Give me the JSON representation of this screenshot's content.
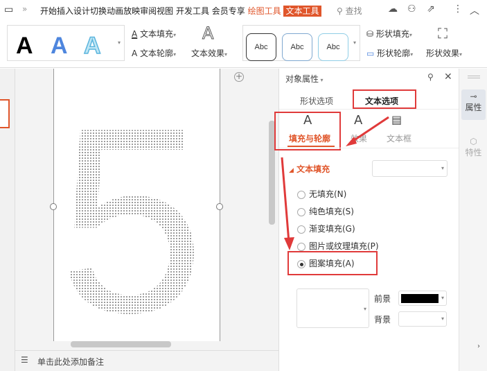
{
  "menu": {
    "items": [
      "开始",
      "插入",
      "设计",
      "切换",
      "动画",
      "放映",
      "审阅",
      "视图",
      "开发工具",
      "会员专享"
    ],
    "draw_tools": "绘图工具",
    "text_tools": "文本工具",
    "search": "查找"
  },
  "ribbon": {
    "text_styles": [
      "A",
      "A",
      "A"
    ],
    "text_fill": "文本填充",
    "text_outline": "文本轮廓",
    "text_effect": "文本效果",
    "shape_styles": [
      "Abc",
      "Abc",
      "Abc"
    ],
    "shape_fill": "形状填充",
    "shape_outline": "形状轮廓",
    "shape_effect": "形状效果"
  },
  "slide": {
    "digit": "5"
  },
  "notes": {
    "placeholder": "单击此处添加备注"
  },
  "panel": {
    "title": "对象属性",
    "tabs": [
      "形状选项",
      "文本选项"
    ],
    "subtabs": [
      "填充与轮廓",
      "效果",
      "文本框"
    ],
    "section": "文本填充",
    "options": [
      "无填充(N)",
      "纯色填充(S)",
      "渐变填充(G)",
      "图片或纹理填充(P)",
      "图案填充(A)"
    ],
    "selected": 4,
    "foreground_label": "前景",
    "background_label": "背景",
    "foreground_color": "#000000"
  },
  "side": {
    "properties": "属性",
    "features": "特性"
  },
  "colors": {
    "accent": "#e0562b",
    "highlight": "#e03a3a"
  }
}
